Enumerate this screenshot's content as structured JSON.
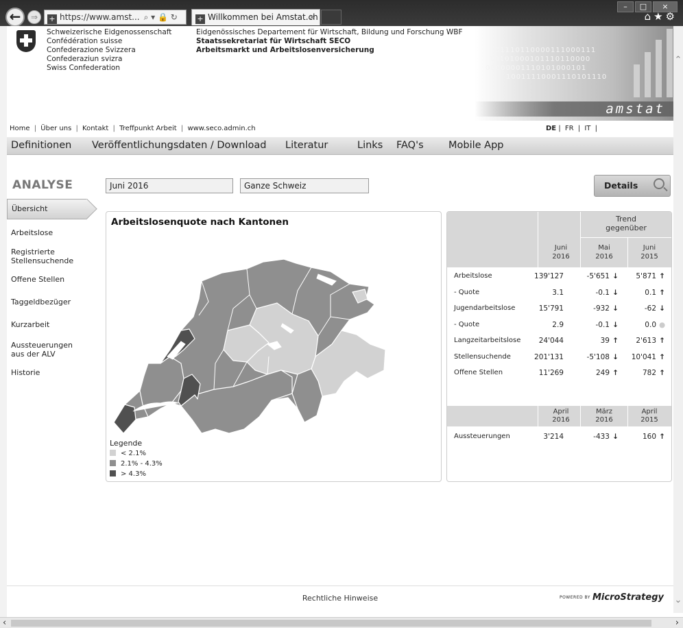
{
  "browser": {
    "url": "https://www.amst...",
    "url_tools": "⌕ ▾ 🔒 ↻",
    "tab_title": "Willkommen bei Amstat.ch",
    "tab_close": "×"
  },
  "header": {
    "confederation": [
      "Schweizerische Eidgenossenschaft",
      "Confédération suisse",
      "Confederazione Svizzera",
      "Confederaziun svizra",
      "Swiss Confederation"
    ],
    "department": "Eidgenössisches Departement für Wirtschaft, Bildung und Forschung WBF",
    "secretariat": "Staatssekretariat für Wirtschaft SECO",
    "unit": "Arbeitsmarkt und Arbeitslosenversicherung",
    "brand": "amstat",
    "banner_digits": [
      "01110110000111000111",
      "10101000101110110000",
      "00000001110101000101",
      "10011110001110101110"
    ]
  },
  "topnav": {
    "items": [
      "Home",
      "|",
      "Über uns",
      "|",
      "Kontakt",
      "|",
      "Treffpunkt Arbeit",
      "|",
      "www.seco.admin.ch"
    ],
    "languages": [
      "DE",
      "|",
      "FR",
      "|",
      "IT",
      "|"
    ]
  },
  "mainnav": [
    "Definitionen",
    "Veröffentlichungsdaten / Download",
    "Literatur",
    "Links",
    "FAQ's",
    "Mobile App"
  ],
  "analyse": {
    "heading": "ANALYSE",
    "period": "Juni 2016",
    "region": "Ganze Schweiz",
    "details_label": "Details"
  },
  "side_menu": {
    "active": "Übersicht",
    "items": [
      "Arbeitslose",
      "Registrierte\nStellensuchende",
      "Offene Stellen",
      "Taggeldbezüger",
      "Kurzarbeit",
      "Aussteuerungen\naus der ALV",
      "Historie"
    ]
  },
  "map": {
    "title": "Arbeitslosenquote nach Kantonen",
    "legend_title": "Legende",
    "legend": [
      {
        "label": "< 2.1%",
        "color": "#d2d2d2"
      },
      {
        "label": "2.1% - 4.3%",
        "color": "#8f8f8f"
      },
      {
        "label": "> 4.3%",
        "color": "#505050"
      }
    ]
  },
  "table": {
    "trend_title": "Trend\ngegenüber",
    "columns": [
      "Juni\n2016",
      "Mai\n2016",
      "Juni\n2015"
    ],
    "rows": [
      {
        "label": "Arbeitslose",
        "value": "139'127",
        "vs_prev_month": "-5'651",
        "pm_dir": "down",
        "vs_prev_year": "5'871",
        "py_dir": "up"
      },
      {
        "label": "- Quote",
        "value": "3.1",
        "vs_prev_month": "-0.1",
        "pm_dir": "down",
        "vs_prev_year": "0.1",
        "py_dir": "up"
      },
      {
        "label": "Jugendarbeitslose",
        "value": "15'791",
        "vs_prev_month": "-932",
        "pm_dir": "down",
        "vs_prev_year": "-62",
        "py_dir": "down"
      },
      {
        "label": "- Quote",
        "value": "2.9",
        "vs_prev_month": "-0.1",
        "pm_dir": "down",
        "vs_prev_year": "0.0",
        "py_dir": "neutral"
      },
      {
        "label": "Langzeitarbeitslose",
        "value": "24'044",
        "vs_prev_month": "39",
        "pm_dir": "up",
        "vs_prev_year": "2'613",
        "py_dir": "up"
      },
      {
        "label": "Stellensuchende",
        "value": "201'131",
        "vs_prev_month": "-5'108",
        "pm_dir": "down",
        "vs_prev_year": "10'041",
        "py_dir": "up"
      },
      {
        "label": "Offene Stellen",
        "value": "11'269",
        "vs_prev_month": "249",
        "pm_dir": "up",
        "vs_prev_year": "782",
        "py_dir": "up"
      }
    ],
    "columns2": [
      "April\n2016",
      "März\n2016",
      "April\n2015"
    ],
    "rows2": [
      {
        "label": "Aussteuerungen",
        "value": "3'214",
        "vs_prev_month": "-433",
        "pm_dir": "down",
        "vs_prev_year": "160",
        "py_dir": "up"
      }
    ]
  },
  "footer": {
    "legal": "Rechtliche Hinweise",
    "powered_by": "POWERED BY",
    "vendor": "MicroStrategy"
  },
  "colors": {
    "low": "#d2d2d2",
    "mid": "#8f8f8f",
    "high": "#505050"
  }
}
